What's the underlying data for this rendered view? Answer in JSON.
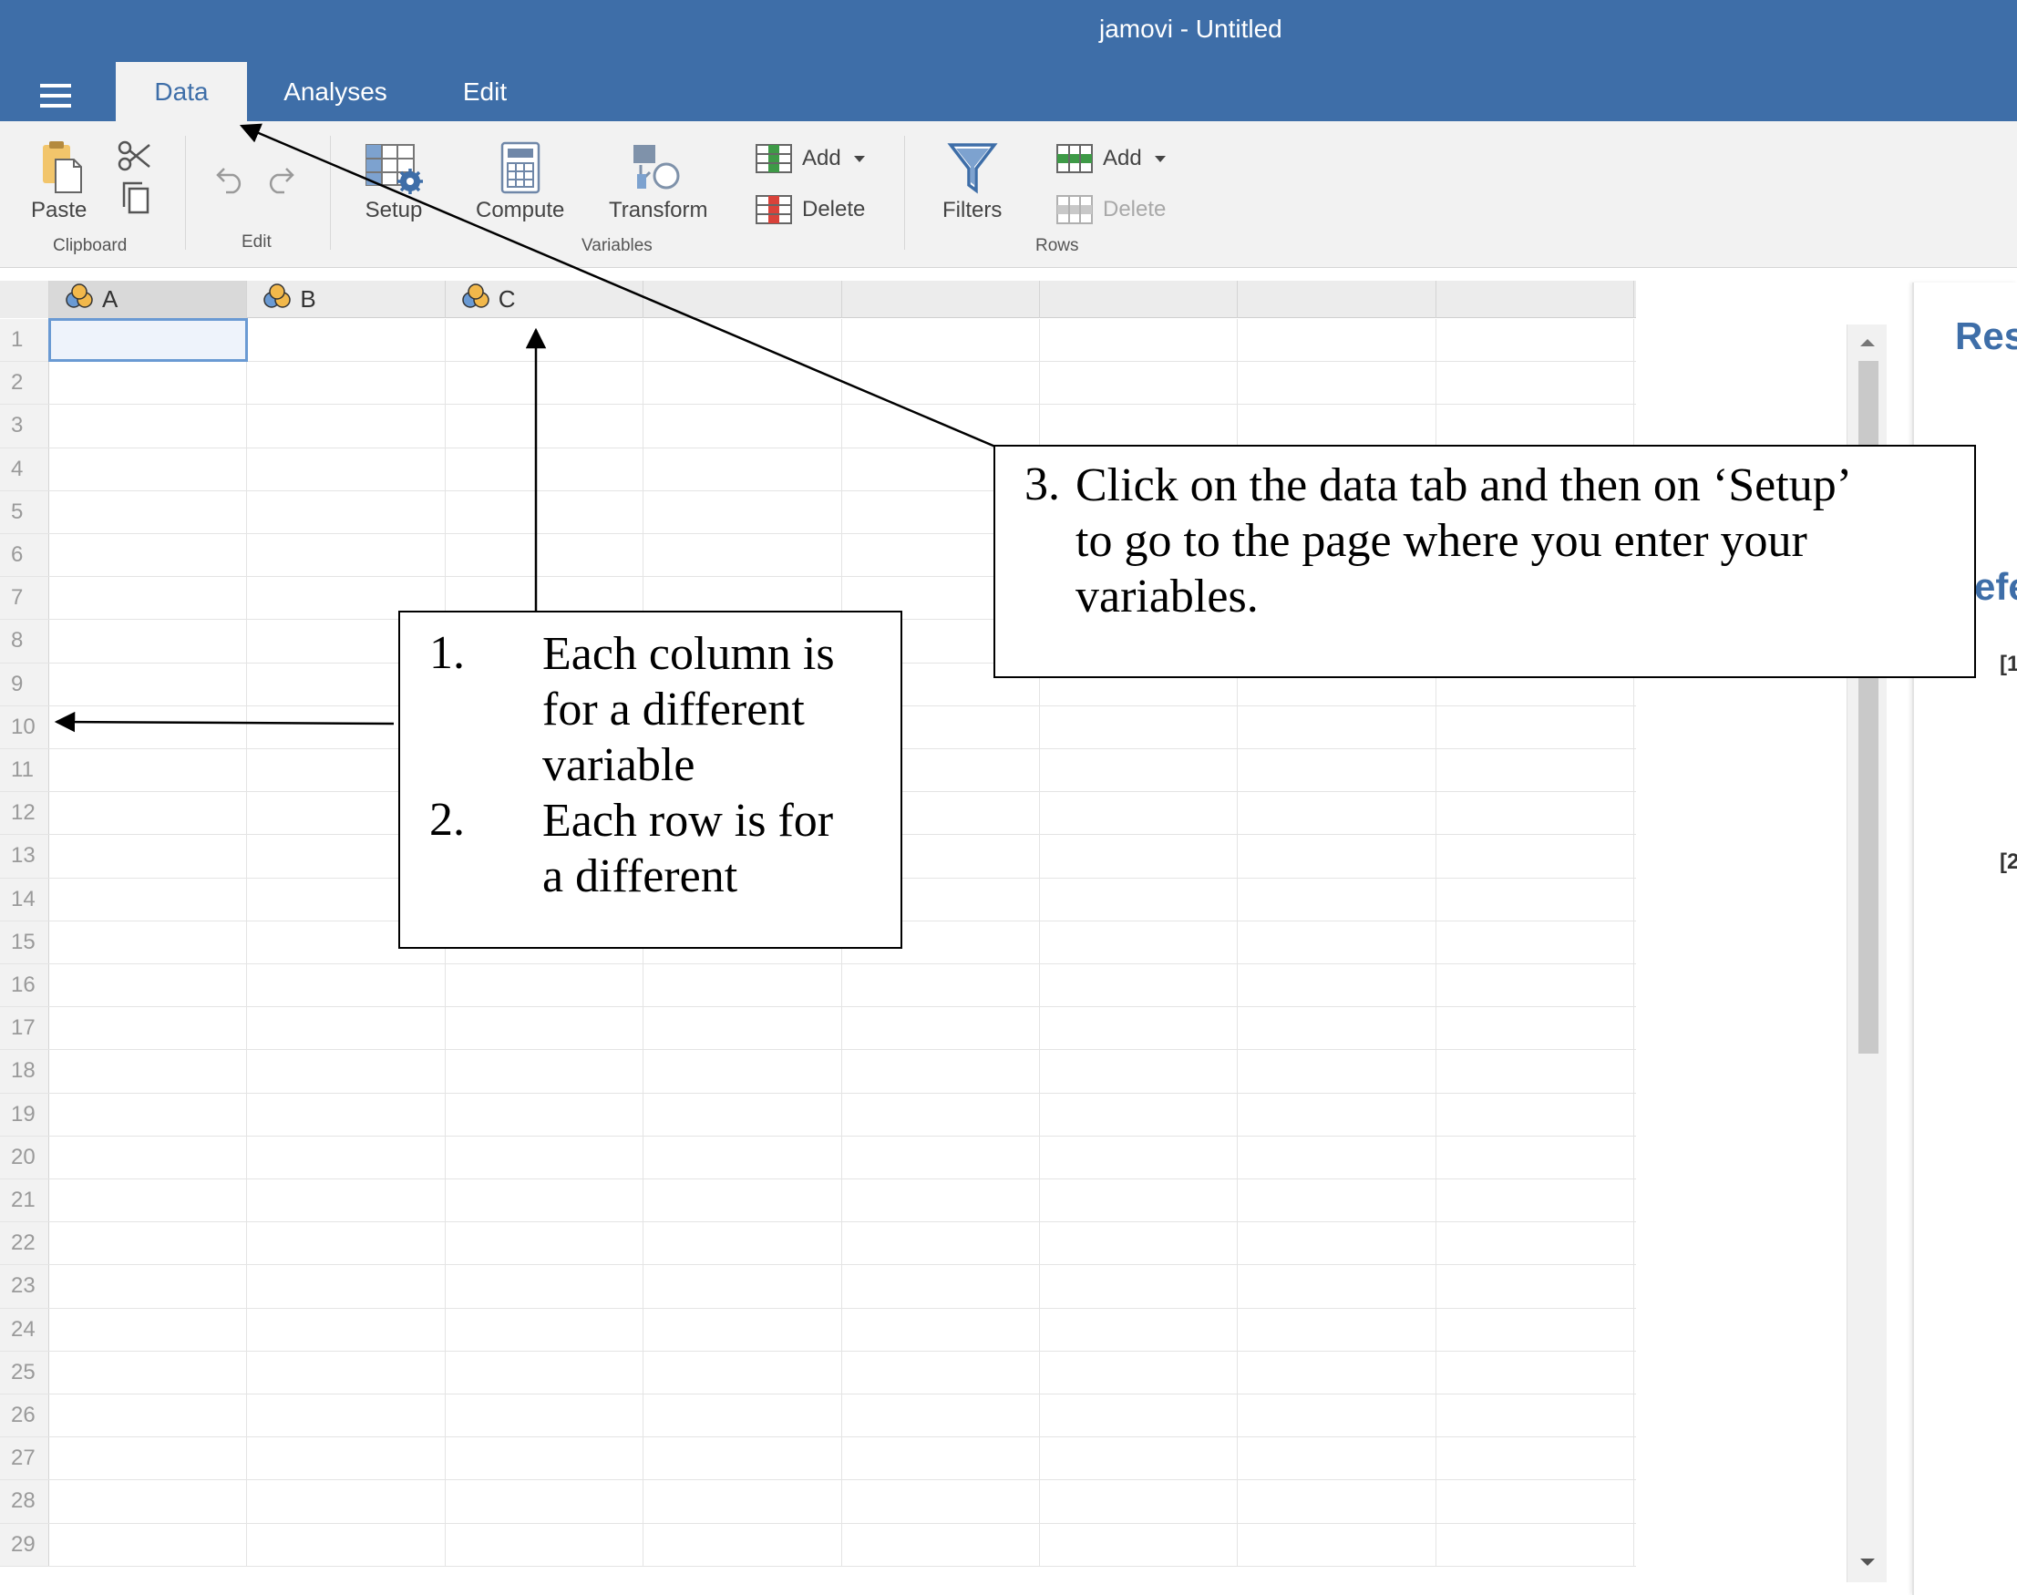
{
  "window": {
    "title": "jamovi - Untitled"
  },
  "tabs": [
    {
      "label": "Data",
      "active": true
    },
    {
      "label": "Analyses",
      "active": false
    },
    {
      "label": "Edit",
      "active": false
    }
  ],
  "ribbon": {
    "clipboard": {
      "paste_label": "Paste",
      "group_label": "Clipboard"
    },
    "edit": {
      "group_label": "Edit"
    },
    "variables": {
      "setup_label": "Setup",
      "compute_label": "Compute",
      "transform_label": "Transform",
      "add_label": "Add",
      "delete_label": "Delete",
      "group_label": "Variables"
    },
    "filters": {
      "label": "Filters"
    },
    "rows": {
      "add_label": "Add",
      "delete_label": "Delete",
      "group_label": "Rows"
    }
  },
  "spreadsheet": {
    "columns": [
      "A",
      "B",
      "C",
      "",
      "",
      "",
      "",
      ""
    ],
    "rows": [
      "1",
      "2",
      "3",
      "4",
      "5",
      "6",
      "7",
      "8",
      "9",
      "10",
      "11",
      "12",
      "13",
      "14",
      "15",
      "16",
      "17",
      "18",
      "19",
      "20",
      "21",
      "22",
      "23",
      "24",
      "25",
      "26",
      "27",
      "28",
      "29"
    ],
    "selected_cell": "A1"
  },
  "results_pane": {
    "title_partial": "Res",
    "references_partial": "efe",
    "ref1": "[1",
    "ref2": "[2"
  },
  "annotations": {
    "callout_1_num": "1.",
    "callout_1_lines": [
      "Each column is",
      "for a different",
      "variable"
    ],
    "callout_2_num": "2.",
    "callout_2_lines": [
      "Each row is for",
      "a different"
    ],
    "callout_3_num": "3.",
    "callout_3_lines": [
      "Click on the data tab  and then on  ‘Setup’",
      "to go to the page where you enter your",
      "variables."
    ]
  },
  "colors": {
    "title_bar": "#3e6ea8",
    "ribbon": "#f2f2f2",
    "accent_blue": "#3e6ea8",
    "selection_border": "#6a9ad3"
  }
}
